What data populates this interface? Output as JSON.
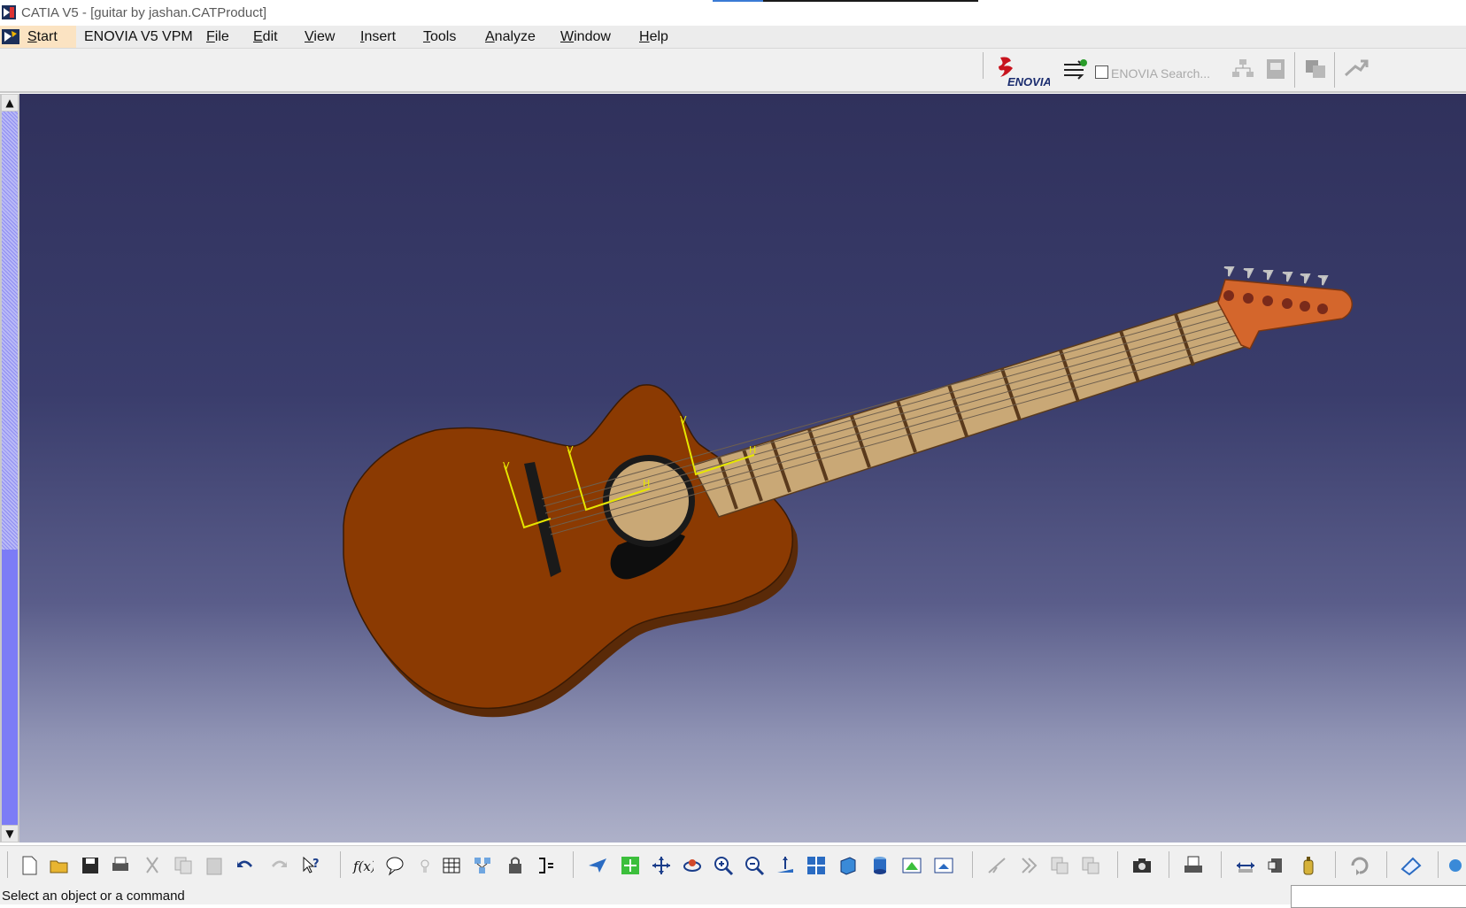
{
  "window": {
    "title": "CATIA V5 - [guitar by jashan.CATProduct]",
    "progress": 0.19
  },
  "menubar": {
    "items": [
      {
        "label": "Start",
        "mnemonic": "S",
        "rest": "tart"
      },
      {
        "label": "ENOVIA V5 VPM",
        "mnemonic": "",
        "rest": "ENOVIA V5 VPM"
      },
      {
        "label": "File",
        "mnemonic": "F",
        "rest": "ile"
      },
      {
        "label": "Edit",
        "mnemonic": "E",
        "rest": "dit"
      },
      {
        "label": "View",
        "mnemonic": "V",
        "rest": "iew"
      },
      {
        "label": "Insert",
        "mnemonic": "I",
        "rest": "nsert"
      },
      {
        "label": "Tools",
        "mnemonic": "T",
        "rest": "ools"
      },
      {
        "label": "Analyze",
        "mnemonic": "A",
        "rest": "nalyze"
      },
      {
        "label": "Window",
        "mnemonic": "W",
        "rest": "indow"
      },
      {
        "label": "Help",
        "mnemonic": "H",
        "rest": "elp"
      }
    ]
  },
  "topbar": {
    "logo_text": "ENOVIA",
    "search_label": "ENOVIA Search...",
    "icons": [
      "enovia-logo-icon",
      "enovia-link-icon",
      "search-checkbox",
      "tree-icon",
      "save-db-icon",
      "open-db-icon",
      "upload-icon"
    ]
  },
  "viewport": {
    "model": "guitar",
    "colors": {
      "body": "#8b3a02",
      "body_side": "#5a2a08",
      "neck": "#c9a876",
      "headstock": "#d4662c",
      "axis": "#e6e600",
      "fret": "#5a3a1c"
    },
    "axis_labels": [
      "V",
      "H"
    ]
  },
  "scrollbar": {
    "up": "▲",
    "down": "▼"
  },
  "toolbar": {
    "icons": [
      "new-icon",
      "open-icon",
      "save-icon",
      "print-icon",
      "cut-icon",
      "copy-icon",
      "paste-icon",
      "undo-icon",
      "redo-icon",
      "whats-this-icon",
      "formula-icon",
      "comment-icon",
      "knowledge-icon",
      "table-icon",
      "catalog-icon",
      "lock-icon",
      "param-icon",
      "fly-mode-icon",
      "fit-all-icon",
      "pan-icon",
      "rotate-icon",
      "zoom-in-icon",
      "zoom-out-icon",
      "normal-view-icon",
      "multi-view-icon",
      "iso-view-icon",
      "shading-icon",
      "hide-show-icon",
      "swap-icon",
      "snap-icon",
      "next-icon",
      "copy-format-icon",
      "paste-format-icon",
      "camera-icon",
      "scan-icon",
      "measure-between-icon",
      "measure-item-icon",
      "inertia-icon",
      "update-icon",
      "sketch-icon",
      "more-icon"
    ]
  },
  "status": {
    "message": "Select an object or a command",
    "command_value": ""
  }
}
